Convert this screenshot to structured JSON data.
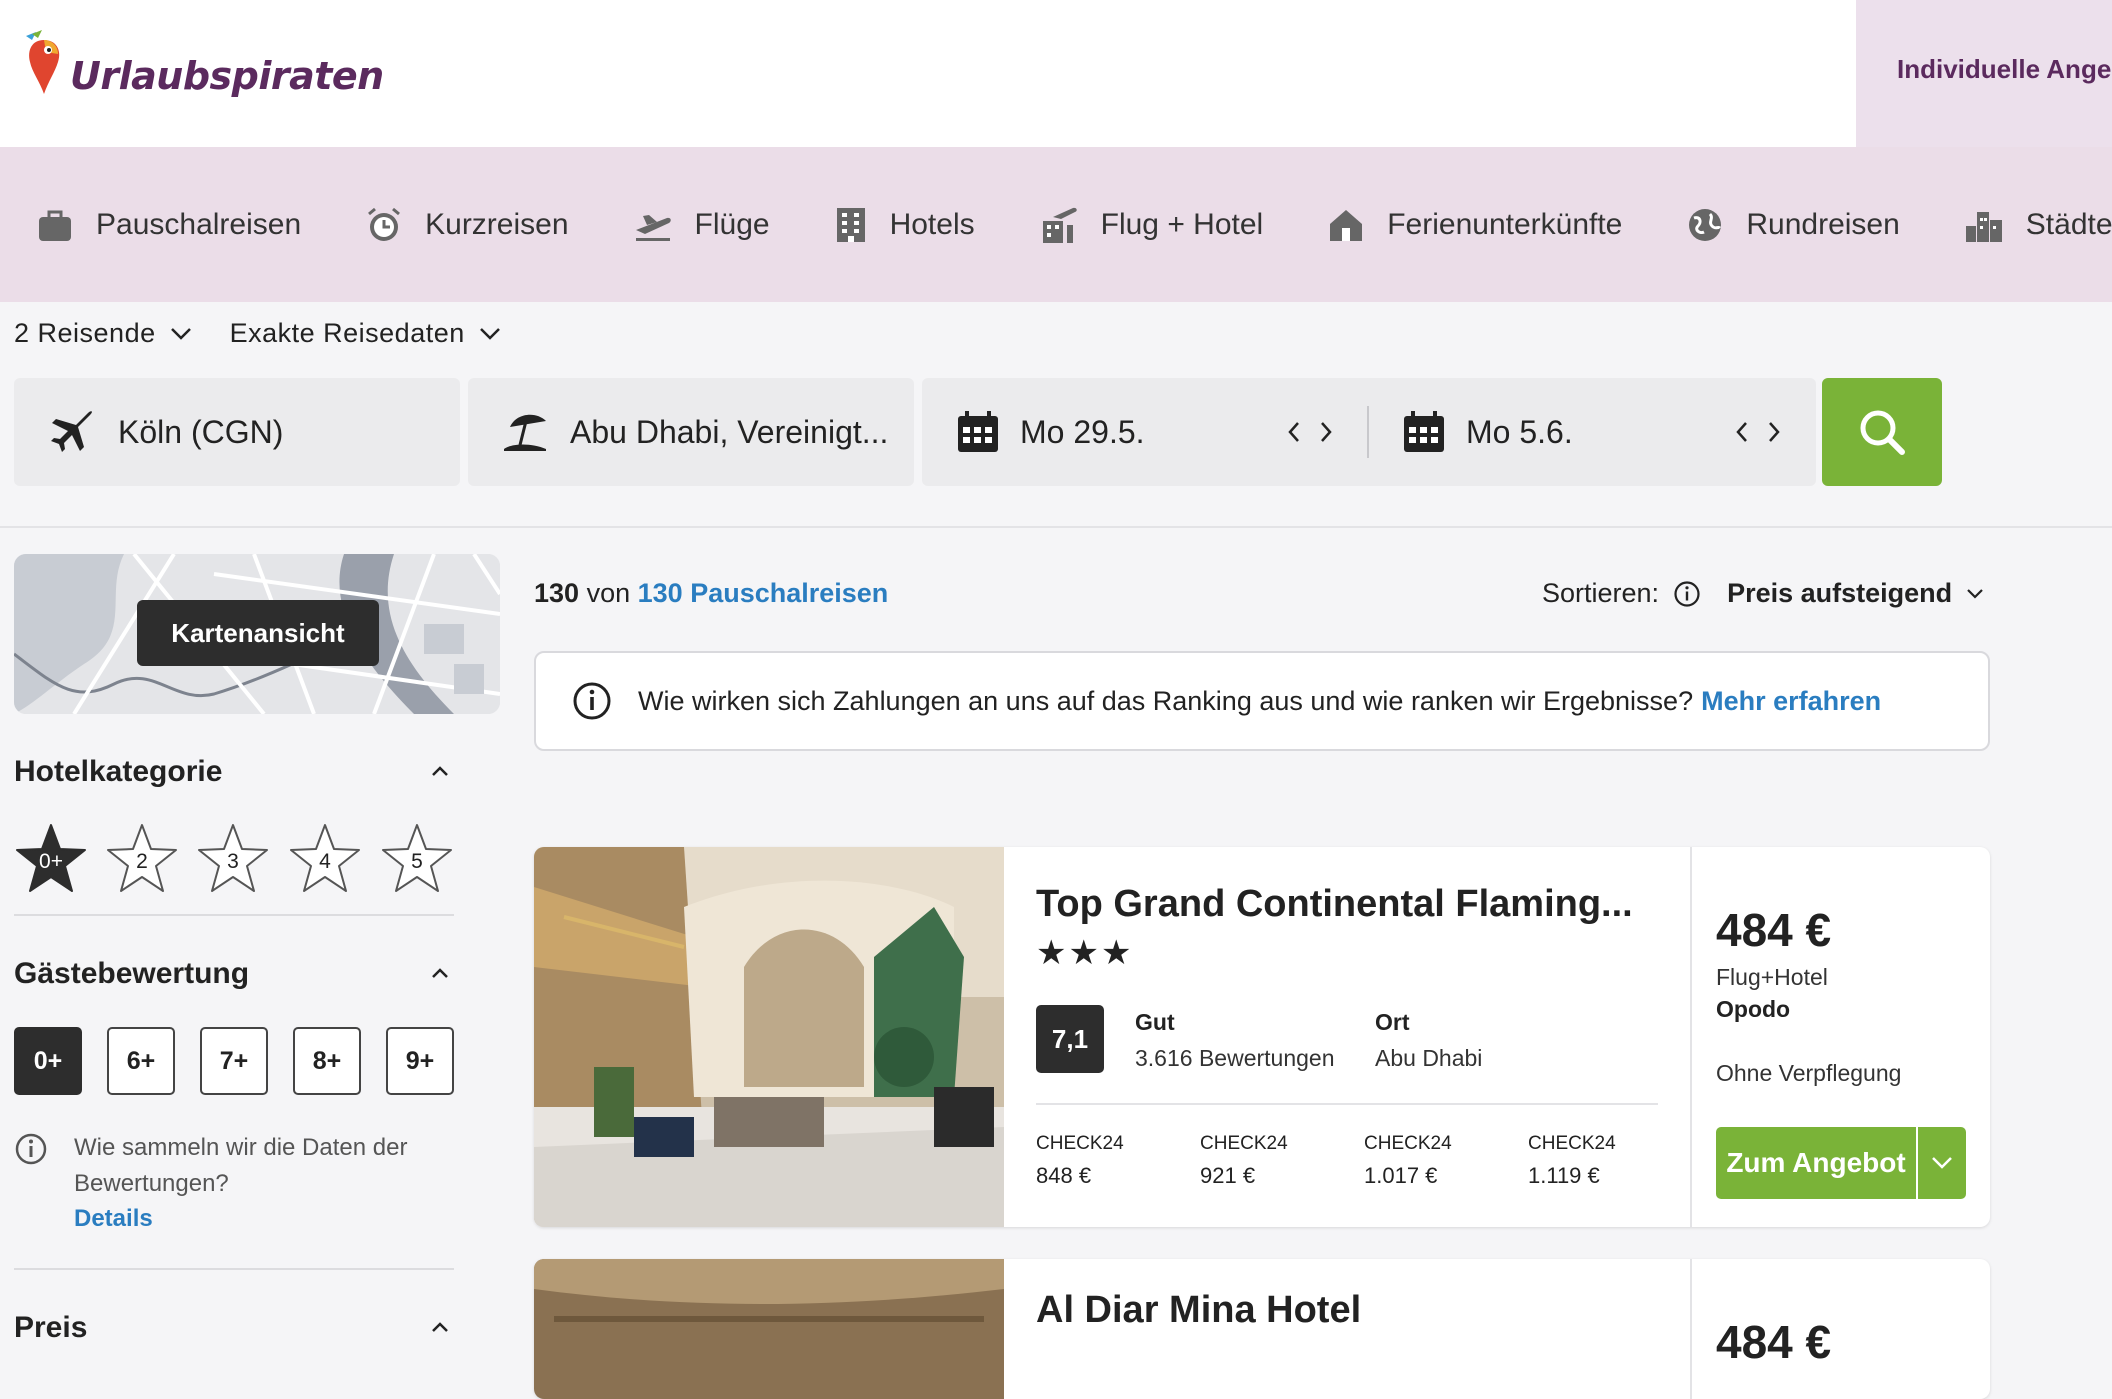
{
  "brand": {
    "name": "Urlaubspiraten",
    "header_link": "Individuelle Ange"
  },
  "nav": [
    {
      "label": "Pauschalreisen",
      "icon": "suitcase-icon"
    },
    {
      "label": "Kurzreisen",
      "icon": "alarm-clock-icon"
    },
    {
      "label": "Flüge",
      "icon": "plane-takeoff-icon"
    },
    {
      "label": "Hotels",
      "icon": "hotel-building-icon"
    },
    {
      "label": "Flug + Hotel",
      "icon": "plane-hotel-icon"
    },
    {
      "label": "Ferienunterkünfte",
      "icon": "house-icon"
    },
    {
      "label": "Rundreisen",
      "icon": "globe-icon"
    },
    {
      "label": "Städterei",
      "icon": "city-icon"
    }
  ],
  "search": {
    "travelers": "2 Reisende",
    "date_mode": "Exakte Reisedaten",
    "origin": "Köln (CGN)",
    "destination": "Abu Dhabi, Vereinigt...",
    "date_from": "Mo 29.5.",
    "date_to": "Mo 5.6."
  },
  "sidebar": {
    "map_button": "Kartenansicht",
    "hotel_category": {
      "title": "Hotelkategorie",
      "options": [
        "0+",
        "2",
        "3",
        "4",
        "5"
      ],
      "selected": "0+"
    },
    "guest_rating": {
      "title": "Gästebewertung",
      "options": [
        "0+",
        "6+",
        "7+",
        "8+",
        "9+"
      ],
      "selected": "0+",
      "info": "Wie sammeln wir die Daten der Bewertungen?",
      "details_link": "Details"
    },
    "price": {
      "title": "Preis"
    }
  },
  "results": {
    "count_num": "130",
    "count_von": "von",
    "count_link": "130 Pauschalreisen",
    "sort_label": "Sortieren:",
    "sort_value": "Preis aufsteigend",
    "info_text": "Wie wirken sich Zahlungen an uns auf das Ranking aus und wie ranken wir Ergebnisse?",
    "info_link": "Mehr erfahren"
  },
  "cards": [
    {
      "title": "Top Grand Continental Flaming...",
      "stars": 3,
      "score": "7,1",
      "rating_label": "Gut",
      "reviews": "3.616 Bewertungen",
      "location_label": "Ort",
      "location": "Abu Dhabi",
      "providers": [
        {
          "name": "CHECK24",
          "price": "848 €"
        },
        {
          "name": "CHECK24",
          "price": "921 €"
        },
        {
          "name": "CHECK24",
          "price": "1.017 €"
        },
        {
          "name": "CHECK24",
          "price": "1.119 €"
        }
      ],
      "price": "484 €",
      "price_type": "Flug+Hotel",
      "operator": "Opodo",
      "board": "Ohne Verpflegung",
      "cta": "Zum Angebot"
    },
    {
      "title": "Al Diar Mina Hotel",
      "price": "484 €"
    }
  ]
}
